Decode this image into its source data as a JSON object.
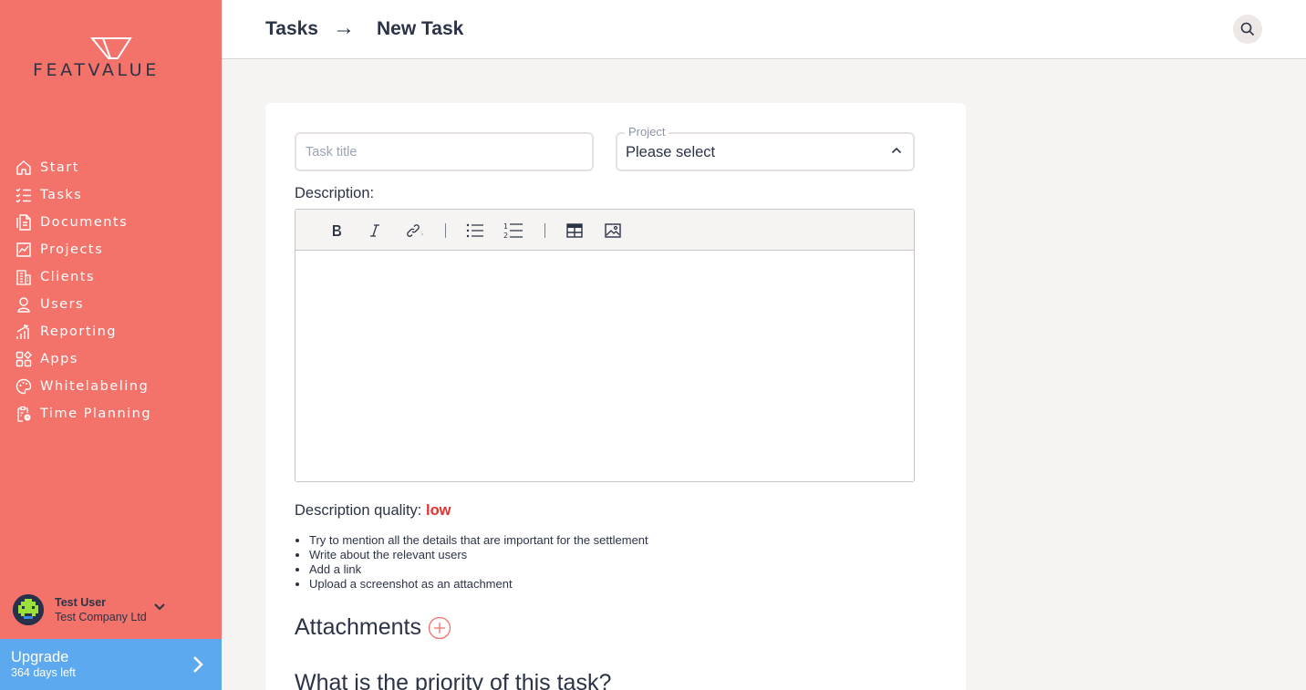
{
  "brand": {
    "name": "FEATVALUE"
  },
  "sidebar": {
    "items": [
      {
        "label": "Start",
        "icon": "home-icon"
      },
      {
        "label": "Tasks",
        "icon": "tasks-icon"
      },
      {
        "label": "Documents",
        "icon": "documents-icon"
      },
      {
        "label": "Projects",
        "icon": "projects-icon"
      },
      {
        "label": "Clients",
        "icon": "clients-icon"
      },
      {
        "label": "Users",
        "icon": "user-icon"
      },
      {
        "label": "Reporting",
        "icon": "reporting-icon"
      },
      {
        "label": "Apps",
        "icon": "apps-icon"
      },
      {
        "label": "Whitelabeling",
        "icon": "palette-icon"
      },
      {
        "label": "Time Planning",
        "icon": "time-planning-icon"
      }
    ]
  },
  "user": {
    "name": "Test User",
    "company": "Test Company Ltd"
  },
  "upgrade": {
    "title": "Upgrade",
    "subtitle": "364 days left"
  },
  "header": {
    "breadcrumb": [
      "Tasks",
      "New Task"
    ],
    "separator": "→"
  },
  "form": {
    "title_placeholder": "Task title",
    "title_value": "",
    "project_label": "Project",
    "project_value": "Please select",
    "description_label": "Description:",
    "quality_label": "Description quality:",
    "quality_value": "low",
    "tips": [
      "Try to mention all the details that are important for the settlement",
      "Write about the relevant users",
      "Add a link",
      "Upload a screenshot as an attachment"
    ],
    "attachments_label": "Attachments",
    "priority_label": "What is the priority of this task?"
  },
  "colors": {
    "sidebar": "#f3726a",
    "upgrade": "#5da9f0",
    "text": "#2b3346",
    "quality_low": "#e3312e"
  }
}
